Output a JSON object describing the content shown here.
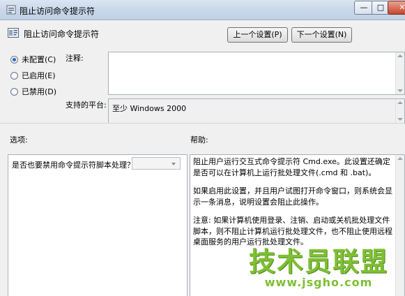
{
  "window": {
    "title": "阻止访问命令提示符",
    "controls": {
      "minimize": "—",
      "maximize": "□",
      "close": "✕"
    }
  },
  "header": {
    "title": "阻止访问命令提示符",
    "prev_button": "上一个设置(P)",
    "next_button": "下一个设置(N)"
  },
  "radios": [
    {
      "label": "未配置(C)",
      "selected": true
    },
    {
      "label": "已启用(E)",
      "selected": false
    },
    {
      "label": "已禁用(D)",
      "selected": false
    }
  ],
  "comment": {
    "label": "注释:",
    "value": ""
  },
  "platform": {
    "label": "支持的平台:",
    "value": "至少 Windows 2000"
  },
  "options": {
    "label": "选项:",
    "question": "是否也要禁用命令提示符脚本处理？",
    "select_value": ""
  },
  "help": {
    "label": "帮助:",
    "paragraphs": [
      "阻止用户运行交互式命令提示符 Cmd.exe。此设置还确定是否可以在计算机上运行批处理文件(.cmd 和 .bat)。",
      "如果启用此设置，并且用户试图打开命令窗口，则系统会显示一条消息，说明设置会阻止此操作。",
      "注意: 如果计算机使用登录、注销、启动或关机批处理文件脚本，则不阻止计算机运行批处理文件，也不阻止使用远程桌面服务的用户运行批处理文件。"
    ]
  },
  "watermark": {
    "text": "技术员联盟",
    "url": "www.jsgho.com"
  }
}
